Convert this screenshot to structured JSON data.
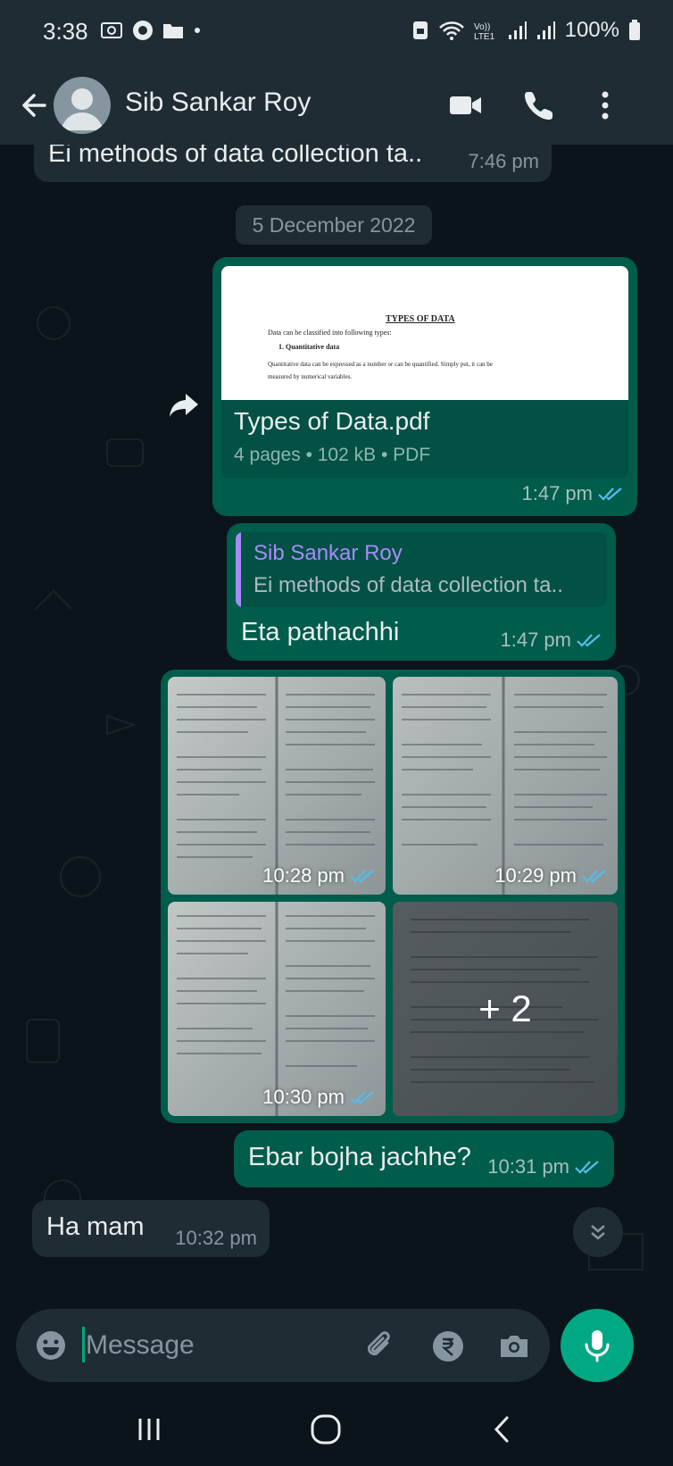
{
  "status_bar": {
    "time": "3:38",
    "battery": "100%"
  },
  "header": {
    "contact_name": "Sib Sankar Roy"
  },
  "messages": {
    "m0": {
      "text": "Ei methods of data collection ta..",
      "time": "7:46 pm"
    },
    "date_divider": "5 December 2022",
    "doc": {
      "preview_title": "TYPES OF DATA",
      "preview_line1": "Data can be classified into following types:",
      "preview_heading": "1.   Quantitative data",
      "preview_line2": "Quantitative data can be expressed as a number or can be quantified. Simply put, it can be",
      "preview_line3": "measured by numerical variables.",
      "file_name": "Types of Data.pdf",
      "file_info": "4 pages • 102 kB • PDF",
      "time": "1:47 pm"
    },
    "reply": {
      "quote_name": "Sib Sankar Roy",
      "quote_text": "Ei methods of data collection ta..",
      "text": "Eta pathachhi",
      "time": "1:47 pm"
    },
    "photos": [
      {
        "time": "10:28 pm"
      },
      {
        "time": "10:29 pm"
      },
      {
        "time": "10:30 pm"
      },
      {
        "more": "+ 2"
      }
    ],
    "m_out": {
      "text": "Ebar bojha jachhe?",
      "time": "10:31 pm"
    },
    "m_in": {
      "text": "Ha mam",
      "time": "10:32 pm"
    }
  },
  "composer": {
    "placeholder": "Message"
  },
  "colors": {
    "header": "#1f2c34",
    "chat_bg": "#0b141a",
    "outgoing": "#005c4b",
    "incoming": "#202c33",
    "accent": "#00a884",
    "read_ticks": "#53bdeb"
  },
  "icons": [
    "back-arrow-icon",
    "video-call-icon",
    "phone-icon",
    "more-vert-icon",
    "forward-icon",
    "double-check-icon",
    "emoji-icon",
    "attach-icon",
    "rupee-icon",
    "camera-icon",
    "mic-icon",
    "chevrons-down-icon",
    "recents-icon",
    "home-icon",
    "nav-back-icon"
  ]
}
